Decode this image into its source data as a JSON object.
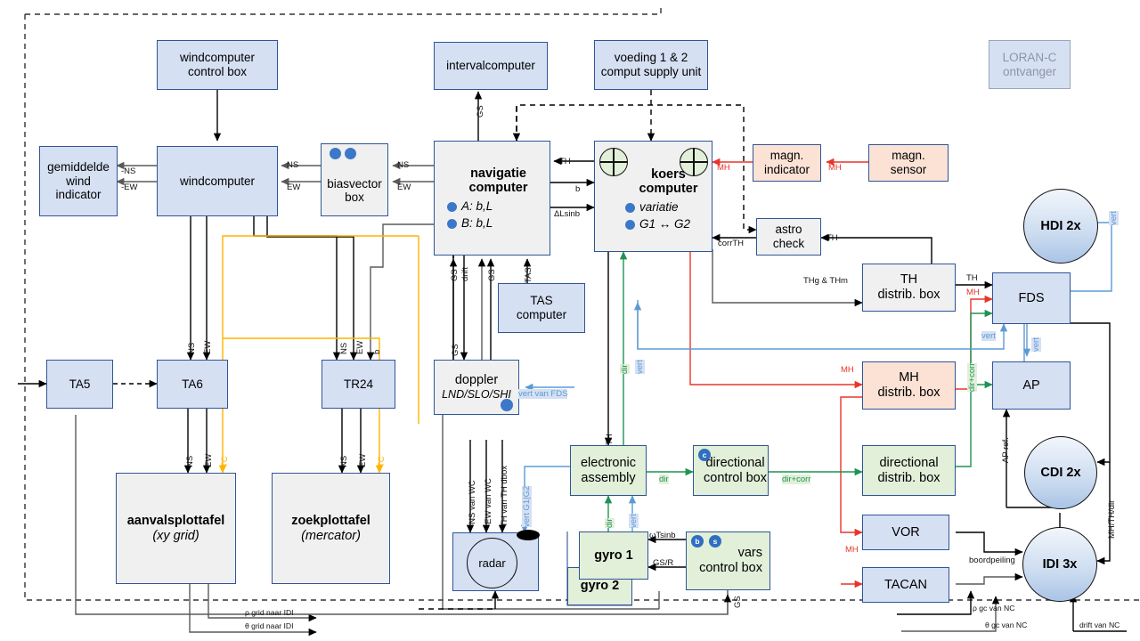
{
  "diagram": {
    "title": "LORAN-C ontvanger",
    "nodes": {
      "windcomputer_control_box": "windcomputer\ncontrol box",
      "windcomputer_control_box_l1": "windcomputer",
      "windcomputer_control_box_l2": "control box",
      "gemiddelde_l1": "gemiddelde",
      "gemiddelde_l2": "wind",
      "gemiddelde_l3": "indicator",
      "windcomputer": "windcomputer",
      "biasvector_l1": "biasvector",
      "biasvector_l2": "box",
      "intervalcomputer": "intervalcomputer",
      "voeding_l1": "voeding 1 & 2",
      "voeding_l2": "comput  supply unit",
      "nav_l1": "navigatie",
      "nav_l2": "computer",
      "nav_a": "A: b,L",
      "nav_b": "B: b,L",
      "koers_l1": "koers",
      "koers_l2": "computer",
      "koers_a": "variatie",
      "koers_b": "G1 ↔ G2",
      "magn_indicator_l1": "magn.",
      "magn_indicator_l2": "indicator",
      "magn_sensor_l1": "magn.",
      "magn_sensor_l2": "sensor",
      "astro_l1": "astro",
      "astro_l2": "check",
      "th_distrib_l1": "TH",
      "th_distrib_l2": "distrib. box",
      "mh_distrib_l1": "MH",
      "mh_distrib_l2": "distrib. box",
      "fds": "FDS",
      "ap": "AP",
      "hdi": "HDI 2x",
      "cdi": "CDI 2x",
      "idi": "IDI 3x",
      "tas_l1": "TAS",
      "tas_l2": "computer",
      "ta5": "TA5",
      "ta6": "TA6",
      "tr24": "TR24",
      "doppler_l1": "doppler",
      "doppler_l2": "LND/SLO/SHI",
      "aanvals_l1": "aanvalsplottafel",
      "aanvals_l2": "(xy grid)",
      "zoek_l1": "zoekplottafel",
      "zoek_l2": "(mercator)",
      "radar": "radar",
      "electronic_l1": "electronic",
      "electronic_l2": "assembly",
      "dircontrol_l1": "directional",
      "dircontrol_l2": "control box",
      "dirdistrib_l1": "directional",
      "dirdistrib_l2": "distrib. box",
      "gyro1": "gyro 1",
      "gyro2": "gyro 2",
      "vars_l1": "vars",
      "vars_l2": "control box",
      "vor": "VOR",
      "tacan": "TACAN",
      "loran_l1": "LORAN-C",
      "loran_l2": "ontvanger"
    },
    "badges": {
      "dircontrol": "c",
      "vars_b": "b",
      "vars_s": "s"
    },
    "edge_labels": {
      "nsneg": "-NS",
      "ewneg": "-EW",
      "ns": "NS",
      "ew": "EW",
      "ns2": "NS",
      "ew2": "EW",
      "gs_interval": "GS",
      "th": "TH",
      "b": "b",
      "dlsinb": "ΔLsinb",
      "mh_ind": "MH",
      "mh_sens": "MH",
      "corrth": "corrTH",
      "th_astro": "TH",
      "thg_thm": "THg & THm",
      "th_fds": "TH",
      "mh_fds": "MH",
      "mh_distrib_in": "MH",
      "vert_hdi": "vert",
      "vert_fds_in": "vert",
      "vert_fds_ap": "vert",
      "dircorr_ap": "dir+corr",
      "ap_ref": "AP ref.",
      "mh_th_dir": "MH/TH/dir",
      "boordpeiling": "boordpeiling",
      "rho_gc": "ρ gc van NC",
      "theta_gc": "θ gc van NC",
      "drift_nc": "drift van NC",
      "mh_vor": "MH",
      "drift": "drift",
      "gs_nav": "GS",
      "tas": "TAS",
      "gs_dop": "GS",
      "vert_van_fds": "vert van FDS",
      "ns_ta6": "NS",
      "ew_ta6": "EW",
      "ns_tr24": "NS",
      "ew_tr24": "EW",
      "b_tr24": "b",
      "ns_plot": "NS",
      "ew_plot": "EW",
      "tc_plot": "TC",
      "ns_plot2": "NS",
      "ew_plot2": "EW",
      "tc_plot2": "TC",
      "rho_grid": "ρ grid naar IDI",
      "theta_grid": "θ grid naar IDI",
      "ns_van_wc": "-NS van WC",
      "ew_van_wc": "-EW van WC",
      "th_van_th_dbox": "TH van TH dbox",
      "vert_g1g2": "vert G1|G2",
      "th_ea": "TH",
      "vert_ea": "vert",
      "dir_ea": "dir",
      "dir_gyro": "dir",
      "vert_gyro": "vert",
      "dir_dcb": "dir",
      "dircorr": "dir+corr",
      "wtsinb": "ωTsinb",
      "gsr": "GS/R",
      "gs_vars": "GS",
      "dir_koers": "dir"
    },
    "colors": {
      "blue_fill": "#d6e0f3",
      "grey_fill": "#f0f0f0",
      "green_fill": "#e2efd9",
      "peach_fill": "#fbe2d5",
      "border": "#2f5597",
      "red": "#e8352b",
      "green_line": "#1e9352",
      "blue_line": "#5b9bd5",
      "orange_line": "#ffb400",
      "grey_line": "#5a5a5a",
      "black": "#000000"
    }
  }
}
